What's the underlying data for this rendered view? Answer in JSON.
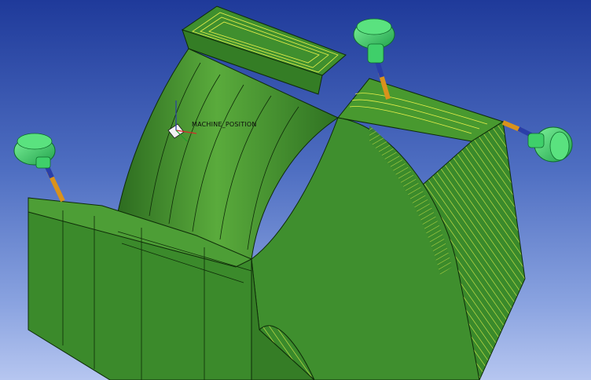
{
  "viewport": {
    "csys_label": "MACHINE_POSITION"
  },
  "colors": {
    "background_top": "#1f3a9a",
    "background_bottom": "#b6c6f0",
    "part_green": "#3f8f2e",
    "part_dark": "#2c6a1f",
    "part_light": "#66b847",
    "toolpath_yellow": "#e8f04a",
    "tool_holder": "#39c86a",
    "tool_orange": "#d9921c",
    "tool_blue": "#2a3ea8"
  },
  "tools": [
    {
      "name": "tool-left",
      "icon": "cutting-tool-icon"
    },
    {
      "name": "tool-top",
      "icon": "cutting-tool-icon"
    },
    {
      "name": "tool-right",
      "icon": "cutting-tool-icon"
    }
  ]
}
